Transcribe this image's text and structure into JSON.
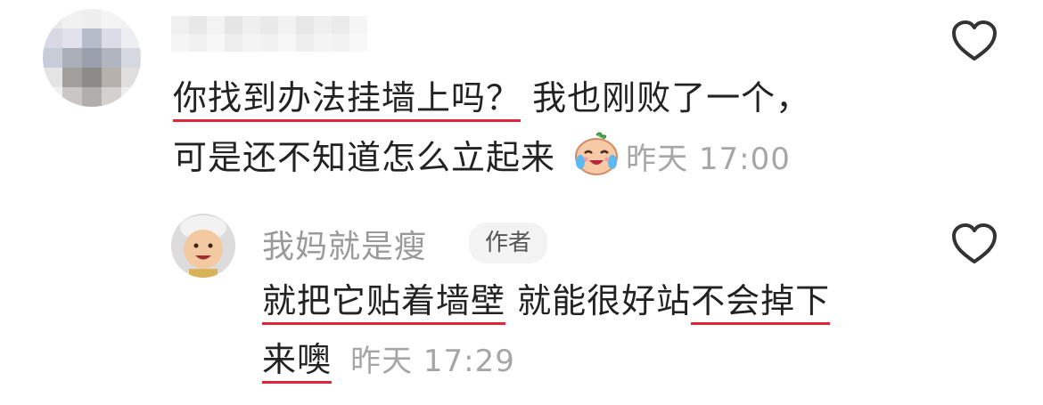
{
  "comment": {
    "line1_underlined": "你找到办法挂墙上吗？",
    "line1_rest": " 我也刚败了一个，",
    "line2": "可是还不知道怎么立起来",
    "emoji_name": "crying-laughing-face-emoji",
    "time": "昨天 17:00"
  },
  "reply": {
    "author": "我妈就是瘦",
    "badge": "作者",
    "line1_part1": "就把它贴着墙壁",
    "line1_part2": " 就能很好站",
    "line1_part3": "不会掉下",
    "line2_part1": "来噢",
    "time": "昨天 17:29"
  },
  "colors": {
    "underline": "#e0263a",
    "meta_text": "#a6a6a6",
    "icon_stroke": "#333333"
  }
}
